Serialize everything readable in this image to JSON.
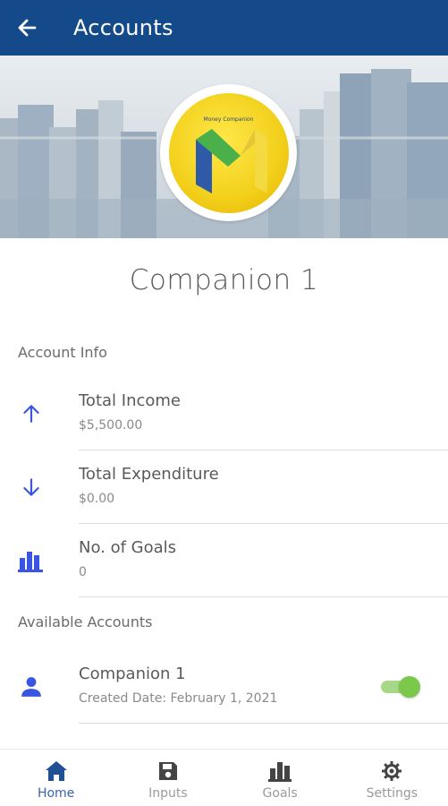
{
  "appbar": {
    "title": "Accounts"
  },
  "hero": {
    "logo_text": "Money Companion"
  },
  "profile": {
    "name": "Companion 1"
  },
  "account_info": {
    "section_label": "Account Info",
    "items": [
      {
        "title": "Total Income",
        "value": "$5,500.00",
        "icon": "arrow-up-icon"
      },
      {
        "title": "Total Expenditure",
        "value": "$0.00",
        "icon": "arrow-down-icon"
      },
      {
        "title": "No. of Goals",
        "value": "0",
        "icon": "bar-chart-icon"
      }
    ]
  },
  "available_accounts": {
    "section_label": "Available Accounts",
    "items": [
      {
        "name": "Companion 1",
        "created": "Created Date: February 1, 2021",
        "icon": "person-icon",
        "enabled": true
      }
    ]
  },
  "nav": {
    "items": [
      {
        "label": "Home",
        "icon": "home-icon",
        "active": true
      },
      {
        "label": "Inputs",
        "icon": "save-icon",
        "active": false
      },
      {
        "label": "Goals",
        "icon": "bar-chart-icon",
        "active": false
      },
      {
        "label": "Settings",
        "icon": "gear-icon",
        "active": false
      }
    ]
  },
  "colors": {
    "primary": "#144a8a",
    "accent_icon": "#3a55e0",
    "nav_active": "#3a63b0",
    "toggle": "#7ac94a"
  }
}
